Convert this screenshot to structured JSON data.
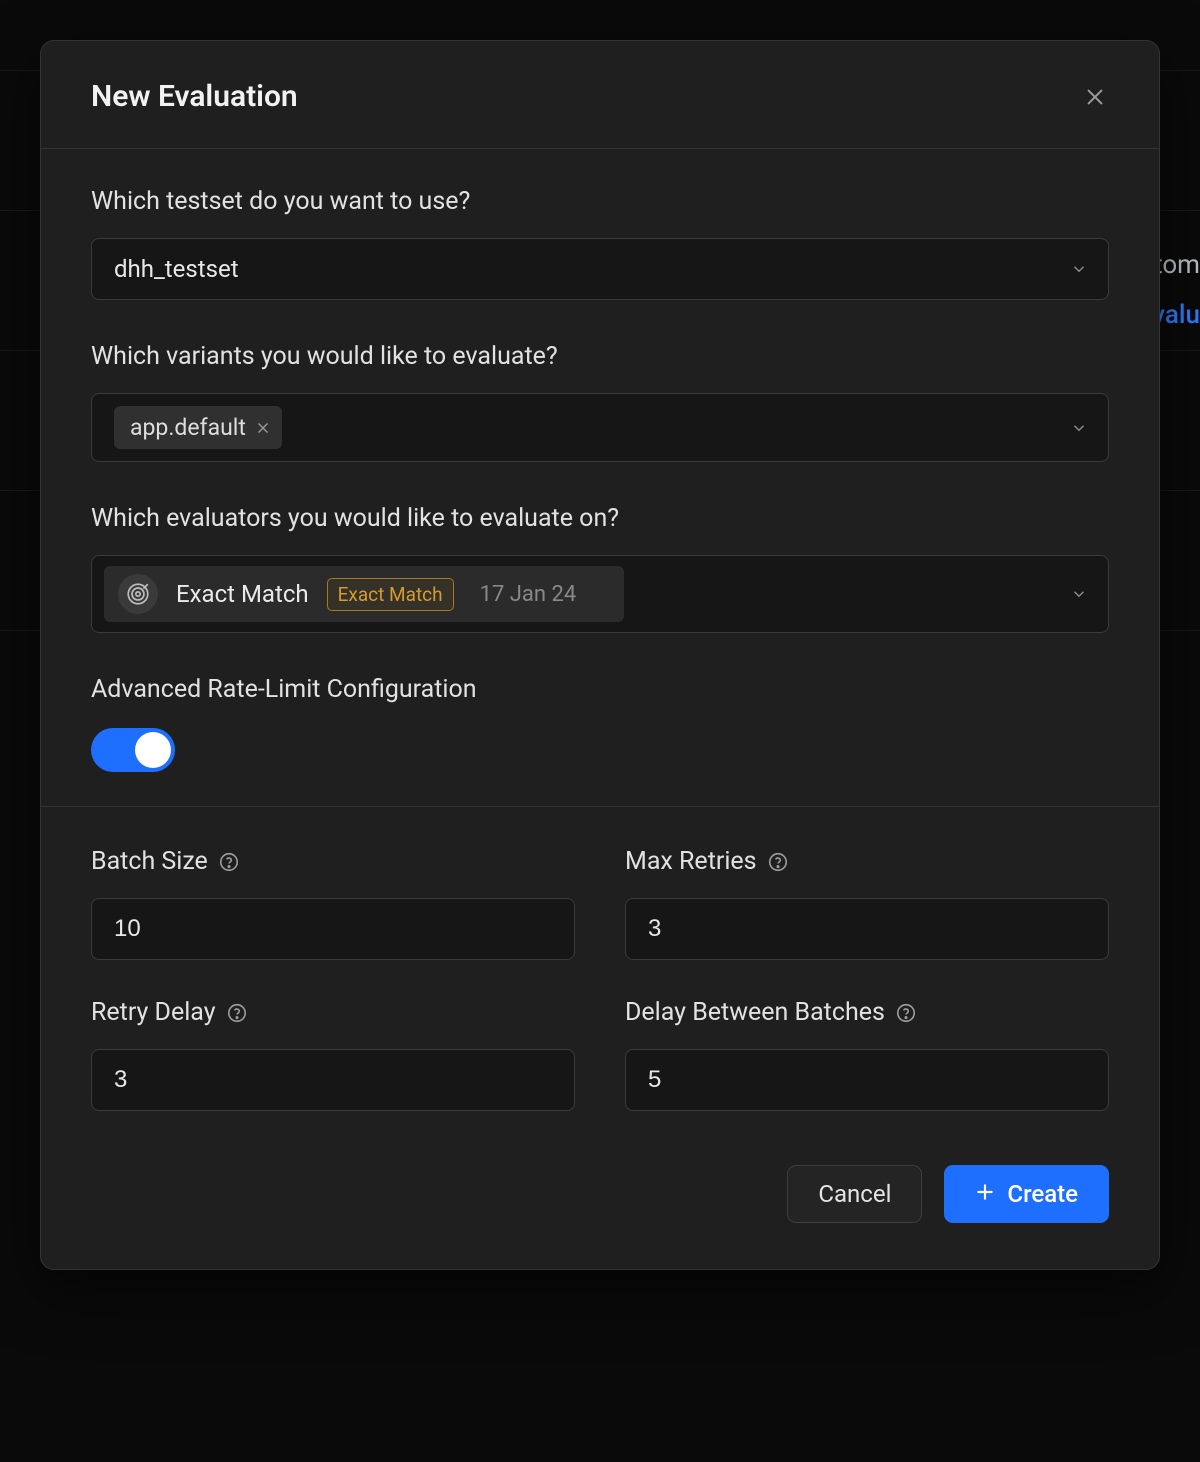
{
  "modal": {
    "title": "New Evaluation",
    "testset": {
      "label": "Which testset do you want to use?",
      "value": "dhh_testset"
    },
    "variants": {
      "label": "Which variants you would like to evaluate?",
      "selected": [
        {
          "name": "app.default"
        }
      ]
    },
    "evaluators": {
      "label": "Which evaluators you would like to evaluate on?",
      "selected": [
        {
          "name": "Exact Match",
          "type_badge": "Exact Match",
          "date": "17 Jan 24",
          "icon": "target"
        }
      ]
    },
    "rate_limit": {
      "label": "Advanced Rate-Limit Configuration",
      "enabled": true,
      "fields": {
        "batch_size": {
          "label": "Batch Size",
          "value": "10"
        },
        "max_retries": {
          "label": "Max Retries",
          "value": "3"
        },
        "retry_delay": {
          "label": "Retry Delay",
          "value": "3"
        },
        "delay_between_batches": {
          "label": "Delay Between Batches",
          "value": "5"
        }
      }
    },
    "buttons": {
      "cancel": "Cancel",
      "create": "Create"
    }
  },
  "background": {
    "fragment1": "stom",
    "fragment2": "Evalu"
  }
}
